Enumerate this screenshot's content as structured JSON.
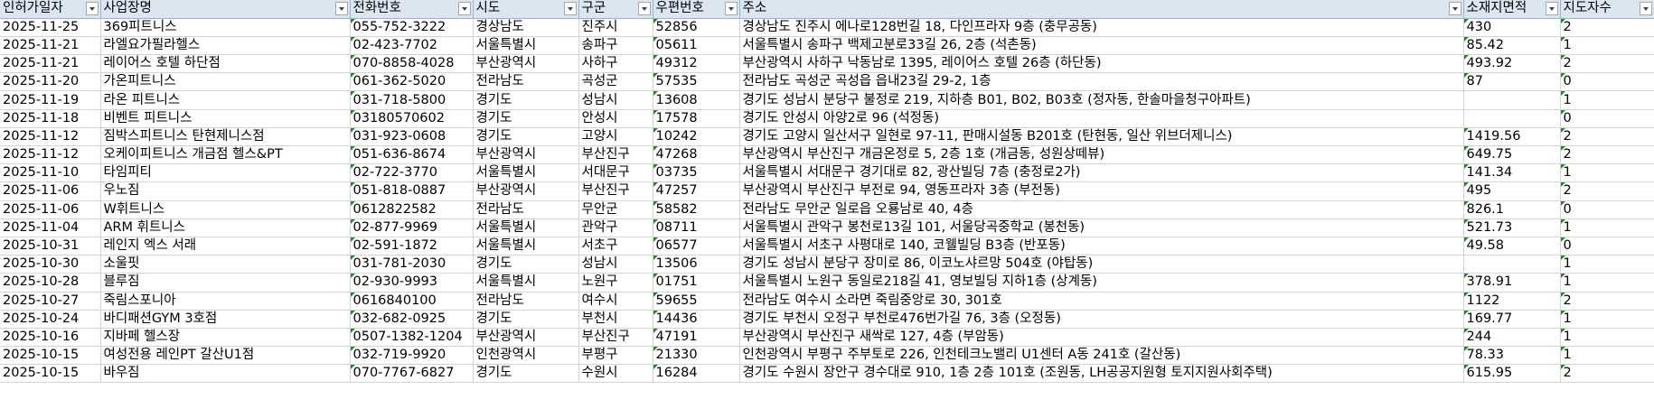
{
  "columns": [
    {
      "label": "인허가일자",
      "key": "date"
    },
    {
      "label": "사업장명",
      "key": "name"
    },
    {
      "label": "전화번호",
      "key": "phone"
    },
    {
      "label": "시도",
      "key": "sido"
    },
    {
      "label": "구군",
      "key": "gugun"
    },
    {
      "label": "우편번호",
      "key": "zip"
    },
    {
      "label": "주소",
      "key": "addr"
    },
    {
      "label": "소재지면적",
      "key": "area"
    },
    {
      "label": "지도자수",
      "key": "staff"
    }
  ],
  "rows": [
    {
      "date": "2025-11-25",
      "name": "369피트니스",
      "phone": "055-752-3222",
      "sido": "경상남도",
      "gugun": "진주시",
      "zip": "52856",
      "addr": "경상남도 진주시 에나로128번길 18, 다인프라자 9층 (충무공동)",
      "area": "430",
      "staff": "2"
    },
    {
      "date": "2025-11-21",
      "name": "라엘요가필라헬스",
      "phone": "02-423-7702",
      "sido": "서울특별시",
      "gugun": "송파구",
      "zip": "05611",
      "addr": "서울특별시 송파구 백제고분로33길 26, 2층 (석촌동)",
      "area": "85.42",
      "staff": "1"
    },
    {
      "date": "2025-11-21",
      "name": "레이어스 호텔 하단점",
      "phone": "070-8858-4028",
      "sido": "부산광역시",
      "gugun": "사하구",
      "zip": "49312",
      "addr": "부산광역시 사하구 낙동남로 1395, 레이어스 호텔 26층 (하단동)",
      "area": "493.92",
      "staff": "2"
    },
    {
      "date": "2025-11-20",
      "name": "가온피트니스",
      "phone": "061-362-5020",
      "sido": "전라남도",
      "gugun": "곡성군",
      "zip": "57535",
      "addr": "전라남도 곡성군 곡성읍 읍내23길 29-2, 1층",
      "area": "87",
      "staff": "0"
    },
    {
      "date": "2025-11-19",
      "name": "라온 피트니스",
      "phone": "031-718-5800",
      "sido": "경기도",
      "gugun": "성남시",
      "zip": "13608",
      "addr": "경기도 성남시 분당구 불정로 219, 지하층 B01, B02, B03호 (정자동, 한솔마을청구아파트)",
      "area": "",
      "staff": "1"
    },
    {
      "date": "2025-11-18",
      "name": "비벤트 피트니스",
      "phone": "03180570602",
      "sido": "경기도",
      "gugun": "안성시",
      "zip": "17578",
      "addr": "경기도 안성시 아양2로 96 (석정동)",
      "area": "",
      "staff": "0"
    },
    {
      "date": "2025-11-12",
      "name": "짐박스피트니스 탄현제니스점",
      "phone": "031-923-0608",
      "sido": "경기도",
      "gugun": "고양시",
      "zip": "10242",
      "addr": "경기도 고양시 일산서구 일현로 97-11, 판매시설동 B201호 (탄현동, 일산 위브더제니스)",
      "area": "1419.56",
      "staff": "2"
    },
    {
      "date": "2025-11-12",
      "name": "오케이피트니스 개금점 헬스&PT",
      "phone": "051-636-8674",
      "sido": "부산광역시",
      "gugun": "부산진구",
      "zip": "47268",
      "addr": "부산광역시 부산진구 개금온정로 5, 2층 1호 (개금동, 성원상떼뷰)",
      "area": "649.75",
      "staff": "2"
    },
    {
      "date": "2025-11-10",
      "name": "타임피티",
      "phone": "02-722-3770",
      "sido": "서울특별시",
      "gugun": "서대문구",
      "zip": "03735",
      "addr": "서울특별시 서대문구 경기대로 82, 광산빌딩 7층 (충정로2가)",
      "area": "141.34",
      "staff": "1"
    },
    {
      "date": "2025-11-06",
      "name": "우노짐",
      "phone": "051-818-0887",
      "sido": "부산광역시",
      "gugun": "부산진구",
      "zip": "47257",
      "addr": "부산광역시 부산진구 부전로 94, 영동프라자 3층 (부전동)",
      "area": "495",
      "staff": "2"
    },
    {
      "date": "2025-11-06",
      "name": "W휘트니스",
      "phone": "0612822582",
      "sido": "전라남도",
      "gugun": "무안군",
      "zip": "58582",
      "addr": "전라남도 무안군 일로읍 오룡남로 40, 4층",
      "area": "826.1",
      "staff": "0"
    },
    {
      "date": "2025-11-04",
      "name": "ARM 휘트니스",
      "phone": "02-877-9969",
      "sido": "서울특별시",
      "gugun": "관악구",
      "zip": "08711",
      "addr": "서울특별시 관악구 봉천로13길 101, 서울당곡중학교 (봉천동)",
      "area": "521.73",
      "staff": "1"
    },
    {
      "date": "2025-10-31",
      "name": "레인지 엑스 서래",
      "phone": "02-591-1872",
      "sido": "서울특별시",
      "gugun": "서초구",
      "zip": "06577",
      "addr": "서울특별시 서초구 사평대로 140, 코웰빌딩 B3층 (반포동)",
      "area": "49.58",
      "staff": "0"
    },
    {
      "date": "2025-10-30",
      "name": "소울핏",
      "phone": "031-781-2030",
      "sido": "경기도",
      "gugun": "성남시",
      "zip": "13506",
      "addr": "경기도 성남시 분당구 장미로 86, 이코노샤르망 504호 (야탑동)",
      "area": "",
      "staff": "1"
    },
    {
      "date": "2025-10-28",
      "name": "블루짐",
      "phone": "02-930-9993",
      "sido": "서울특별시",
      "gugun": "노원구",
      "zip": "01751",
      "addr": "서울특별시 노원구 동일로218길 41, 영보빌딩 지하1층 (상계동)",
      "area": "378.91",
      "staff": "1"
    },
    {
      "date": "2025-10-27",
      "name": "죽림스포니아",
      "phone": "0616840100",
      "sido": "전라남도",
      "gugun": "여수시",
      "zip": "59655",
      "addr": "전라남도 여수시 소라면 죽림중앙로 30, 301호",
      "area": "1122",
      "staff": "2"
    },
    {
      "date": "2025-10-24",
      "name": "바디패션GYM 3호점",
      "phone": "032-682-0925",
      "sido": "경기도",
      "gugun": "부천시",
      "zip": "14436",
      "addr": "경기도 부천시 오정구 부천로476번가길 76, 3층 (오정동)",
      "area": "169.77",
      "staff": "1"
    },
    {
      "date": "2025-10-16",
      "name": "지바페 헬스장",
      "phone": "0507-1382-1204",
      "sido": "부산광역시",
      "gugun": "부산진구",
      "zip": "47191",
      "addr": "부산광역시 부산진구 새싹로 127, 4층 (부암동)",
      "area": "244",
      "staff": "1"
    },
    {
      "date": "2025-10-15",
      "name": "여성전용 레인PT 갈산U1점",
      "phone": "032-719-9920",
      "sido": "인천광역시",
      "gugun": "부평구",
      "zip": "21330",
      "addr": "인천광역시 부평구 주부토로 226, 인천테크노밸리 U1센터 A동 241호 (갈산동)",
      "area": "78.33",
      "staff": "1"
    },
    {
      "date": "2025-10-15",
      "name": "바우짐",
      "phone": "070-7767-6827",
      "sido": "경기도",
      "gugun": "수원시",
      "zip": "16284",
      "addr": "경기도 수원시 장안구 경수대로 910, 1층 2층 101호 (조원동, LH공공지원형 토지지원사회주택)",
      "area": "615.95",
      "staff": "2"
    }
  ],
  "colors": {
    "header_bg": "#dce6f1",
    "grid": "#d4d4d4",
    "text_marker": "#1e8c1e"
  }
}
